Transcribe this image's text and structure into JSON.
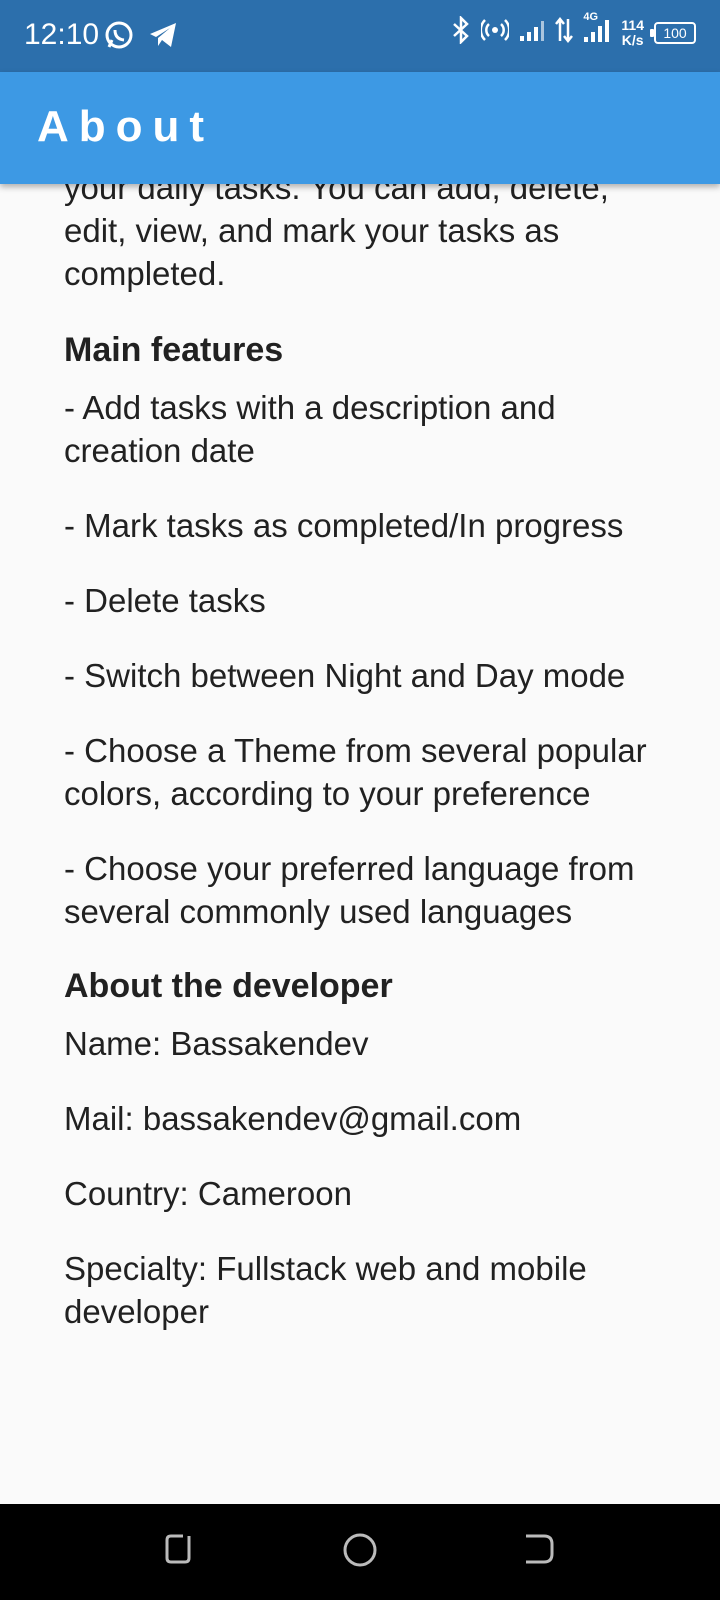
{
  "status_bar": {
    "time": "12:10",
    "speed_value": "114",
    "speed_unit": "K/s",
    "battery": "100",
    "network": "4G"
  },
  "app_bar": {
    "title": "About"
  },
  "content": {
    "intro": "your daily tasks. You can add, delete, edit, view, and mark your tasks as completed.",
    "features_heading": "Main features",
    "features": [
      "- Add tasks with a description and creation date",
      "- Mark tasks as completed/In progress",
      "- Delete tasks",
      "- Switch between Night and Day mode",
      "- Choose a Theme from several popular colors, according to your preference",
      "- Choose your preferred language from several commonly used languages"
    ],
    "developer_heading": "About the developer",
    "developer": {
      "name": "Name: Bassakendev",
      "mail": "Mail: bassakendev@gmail.com",
      "country": "Country: Cameroon",
      "specialty": "Specialty: Fullstack web and mobile developer"
    }
  },
  "colors": {
    "status_bar": "#2c6fac",
    "app_bar": "#3d99e4",
    "background": "#fafafa",
    "text": "#212121"
  }
}
